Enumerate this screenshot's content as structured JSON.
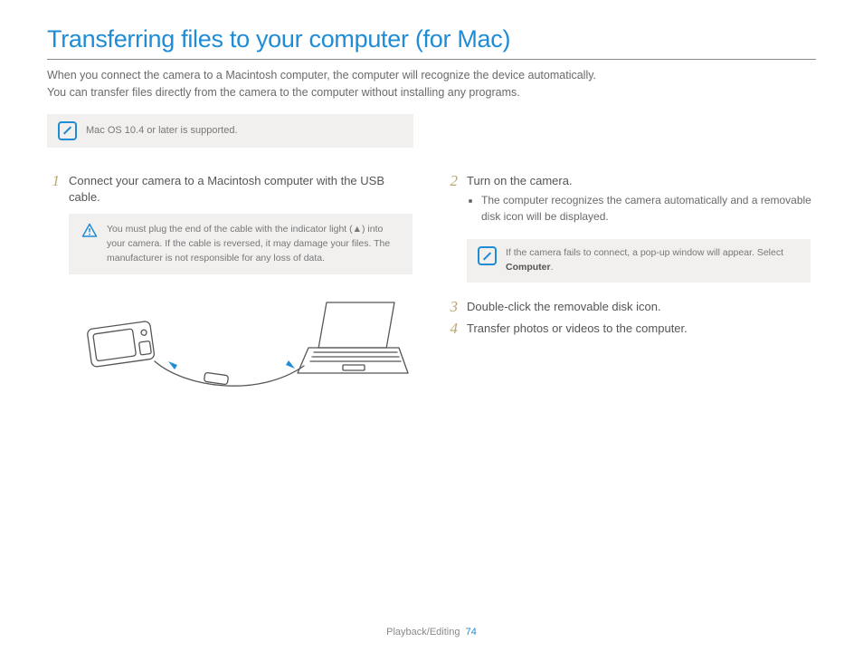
{
  "title": "Transferring files to your computer (for Mac)",
  "intro1": "When you connect the camera to a Macintosh computer, the computer will recognize the device automatically.",
  "intro2": "You can transfer files directly from the camera to the computer without installing any programs.",
  "topnote": "Mac OS 10.4 or later is supported.",
  "left": {
    "step1_num": "1",
    "step1_text": "Connect your camera to a Macintosh computer with the USB cable.",
    "warn": "You must plug the end of the cable with the indicator light (▲) into your camera. If the cable is reversed, it may damage your files. The manufacturer is not responsible for any loss of data."
  },
  "right": {
    "step2_num": "2",
    "step2_text": "Turn on the camera.",
    "step2_bullet": "The computer recognizes the camera automatically and a removable disk icon will be displayed.",
    "note_a": "If the camera fails to connect, a pop-up window will appear. Select ",
    "note_b": "Computer",
    "note_c": ".",
    "step3_num": "3",
    "step3_text": "Double-click the removable disk icon.",
    "step4_num": "4",
    "step4_text": "Transfer photos or videos to the computer."
  },
  "footer_section": "Playback/Editing",
  "footer_page": "74"
}
